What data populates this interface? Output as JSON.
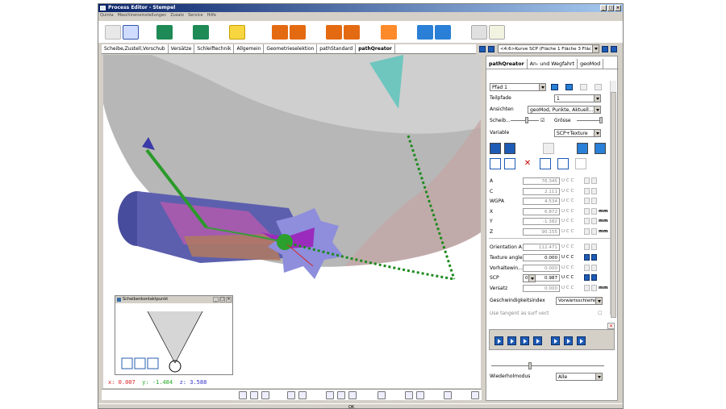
{
  "window": {
    "title": "Process Editor - Stempel"
  },
  "menu": [
    "Quinta",
    "Maschineneinstellungen",
    "Zusatz",
    "Service",
    "Hilfe"
  ],
  "tabs": [
    "Scheibe,Zustell,Vorschub",
    "Versätze",
    "Schleiftechnik",
    "Allgemein",
    "Geometrieselektion",
    "pathStandard",
    "pathQreator"
  ],
  "active_tab": "pathQreator",
  "curve_select": "<4:6>Kurve SCP (Fläche 1 Fläche 3 Fläc",
  "mini_window": {
    "title": "Scheibenkontaktpunkt"
  },
  "coords": {
    "x_label": "x:",
    "x": "0.007",
    "y_label": "y:",
    "y": "-1.484",
    "z_label": "z:",
    "z": "3.588"
  },
  "status": {
    "text": "OK"
  },
  "panel": {
    "tabs": [
      "pathQreator",
      "An- und Wegfahrt",
      "geoMod"
    ],
    "pfad": "Pfad 1",
    "teilpfade_label": "Teilpfade",
    "teilpfade_value": "1",
    "ansichten_label": "Ansichten",
    "ansichten_value": "geoMod, Punkte, Aktuell...",
    "scheib_label": "Scheib...",
    "groesse_label": "Grösse",
    "variable_label": "Variable",
    "variable_value": "SCP+Texture",
    "params": [
      {
        "label": "A",
        "value": "76.345",
        "uc": "U C C",
        "mm": ""
      },
      {
        "label": "C",
        "value": "2.111",
        "uc": "U C C",
        "mm": ""
      },
      {
        "label": "WGPA",
        "value": "4.534",
        "uc": "U C C",
        "mm": ""
      },
      {
        "label": "X",
        "value": "6.872",
        "uc": "U C C",
        "mm": "mm"
      },
      {
        "label": "Y",
        "value": "-1.382",
        "uc": "U C C",
        "mm": "mm"
      },
      {
        "label": "Z",
        "value": "90.155",
        "uc": "U C C",
        "mm": "mm"
      }
    ],
    "params2": [
      {
        "label": "Orientation A",
        "value": "112.471",
        "uc": "U C C",
        "mm": "",
        "on": false
      },
      {
        "label": "Texture angle",
        "value": "0.000",
        "uc": "U C C",
        "mm": "",
        "on": true
      },
      {
        "label": "Vorhaltewin...",
        "value": "0.000",
        "uc": "U C C",
        "mm": "",
        "on": false
      },
      {
        "label": "SCP",
        "value": "0.987",
        "uc": "U C C",
        "mm": "",
        "on": true
      },
      {
        "label": "Versatz",
        "value": "0.000",
        "uc": "U C C",
        "mm": "mm",
        "on": false
      }
    ],
    "scp_select": "0",
    "geschw_label": "Geschwindigkeitsindex",
    "geschw_value": "Vorwärtsschleife",
    "tangent_label": "Use tangent as surf vect",
    "wiederhol_label": "Wiederholmodus",
    "wiederhol_value": "Alle"
  }
}
